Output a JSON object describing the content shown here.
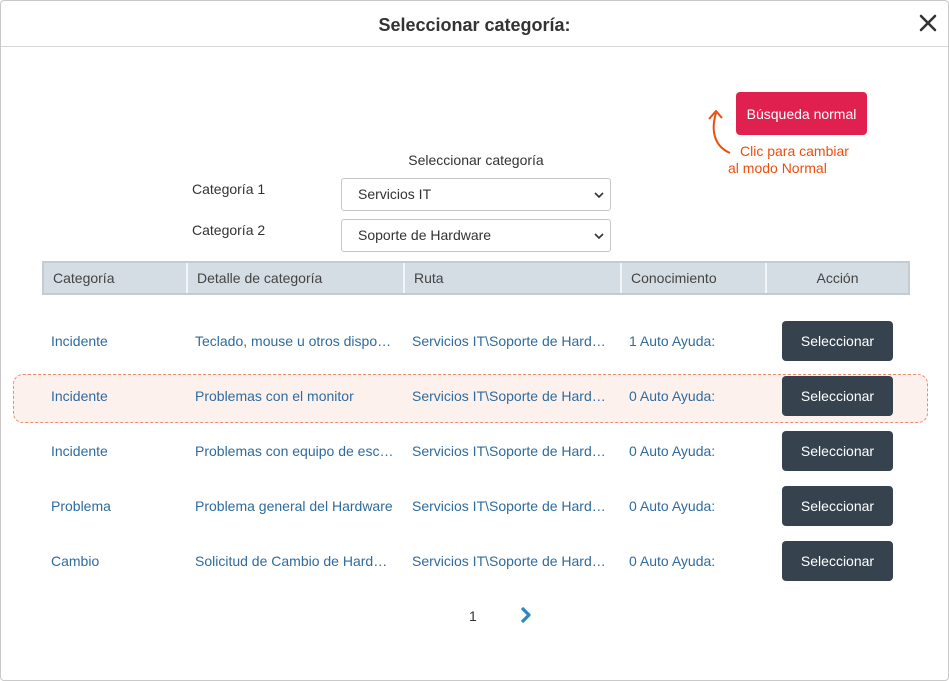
{
  "dialog": {
    "title": "Seleccionar categoría:",
    "close_icon": "close-icon"
  },
  "mode_toggle": {
    "label": "Búsqueda normal",
    "hint_line1": "Clic para cambiar",
    "hint_line2": "al modo Normal",
    "color": "#e0214f",
    "hint_color": "#ee4d0e"
  },
  "filters": {
    "heading": "Seleccionar categoría",
    "category1_label": "Categoría 1",
    "category1_value": "Servicios IT",
    "category2_label": "Categoría 2",
    "category2_value": "Soporte de Hardware"
  },
  "table": {
    "columns": [
      "Categoría",
      "Detalle de categoría",
      "Ruta",
      "Conocimiento",
      "Acción"
    ],
    "rows": [
      {
        "category": "Incidente",
        "detail": "Teclado, mouse u otros dispositivos",
        "path": "Servicios IT\\Soporte de Hardware",
        "knowledge": "1 Auto Ayuda:",
        "action": "Seleccionar",
        "highlighted": false
      },
      {
        "category": "Incidente",
        "detail": "Problemas con el monitor",
        "path": "Servicios IT\\Soporte de Hardware",
        "knowledge": "0 Auto Ayuda:",
        "action": "Seleccionar",
        "highlighted": true
      },
      {
        "category": "Incidente",
        "detail": "Problemas con equipo de escritorio",
        "path": "Servicios IT\\Soporte de Hardware",
        "knowledge": "0 Auto Ayuda:",
        "action": "Seleccionar",
        "highlighted": false
      },
      {
        "category": "Problema",
        "detail": "Problema general del Hardware",
        "path": "Servicios IT\\Soporte de Hardware",
        "knowledge": "0 Auto Ayuda:",
        "action": "Seleccionar",
        "highlighted": false
      },
      {
        "category": "Cambio",
        "detail": "Solicitud de Cambio de Hardware",
        "path": "Servicios IT\\Soporte de Hardware",
        "knowledge": "0 Auto Ayuda:",
        "action": "Seleccionar",
        "highlighted": false
      }
    ]
  },
  "pagination": {
    "current_page": "1",
    "next_icon": "chevron-right-icon"
  }
}
